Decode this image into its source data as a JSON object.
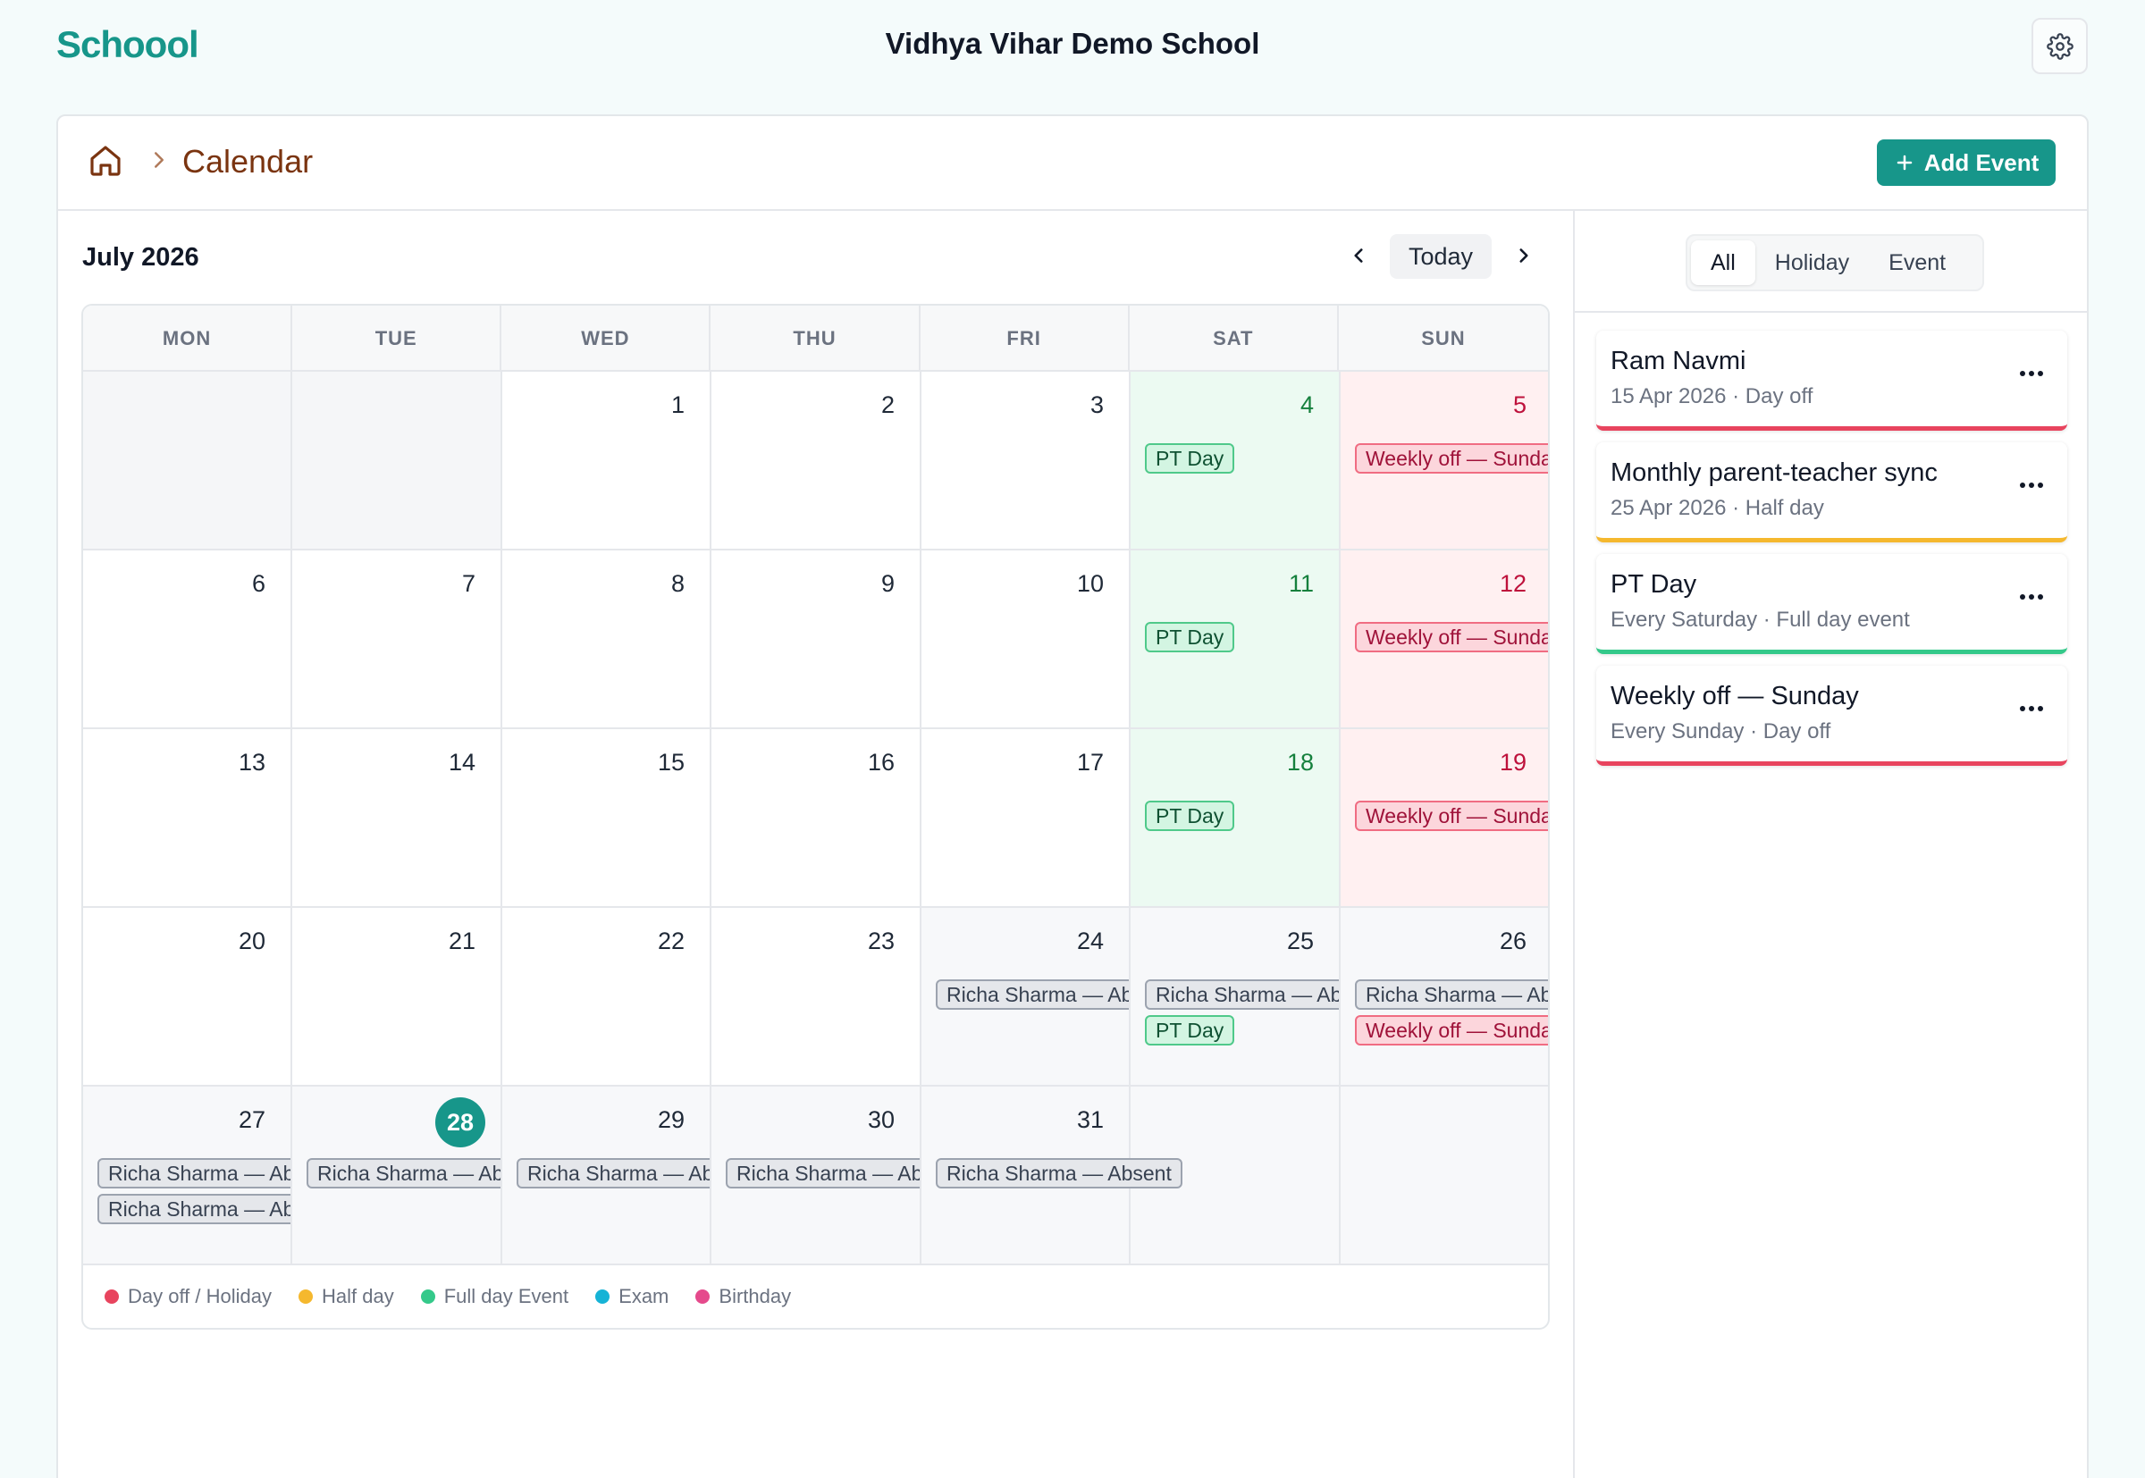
{
  "app": {
    "logo": "Schoool",
    "school_name": "Vidhya Vihar Demo School"
  },
  "breadcrumb": {
    "page_title": "Calendar"
  },
  "toolbar": {
    "add_event_label": "Add Event"
  },
  "calendar": {
    "month_label": "July 2026",
    "today_label": "Today",
    "weekdays": [
      "MON",
      "TUE",
      "WED",
      "THU",
      "FRI",
      "SAT",
      "SUN"
    ],
    "days": {
      "d1": "1",
      "d2": "2",
      "d3": "3",
      "d4": "4",
      "d5": "5",
      "d6": "6",
      "d7": "7",
      "d8": "8",
      "d9": "9",
      "d10": "10",
      "d11": "11",
      "d12": "12",
      "d13": "13",
      "d14": "14",
      "d15": "15",
      "d16": "16",
      "d17": "17",
      "d18": "18",
      "d19": "19",
      "d20": "20",
      "d21": "21",
      "d22": "22",
      "d23": "23",
      "d24": "24",
      "d25": "25",
      "d26": "26",
      "d27": "27",
      "d28": "28",
      "d29": "29",
      "d30": "30",
      "d31": "31"
    },
    "event_labels": {
      "pt_day": "PT Day",
      "weekly_off": "Weekly off — Sunda",
      "absent_short": "Richa Sharma — Ab",
      "absent_full": "Richa Sharma — Absent"
    },
    "legend": [
      {
        "label": "Day off / Holiday",
        "color": "#e8445e"
      },
      {
        "label": "Half day",
        "color": "#f5b82e"
      },
      {
        "label": "Full day Event",
        "color": "#34c98a"
      },
      {
        "label": "Exam",
        "color": "#16b3d6"
      },
      {
        "label": "Birthday",
        "color": "#e54a8c"
      }
    ]
  },
  "sidebar": {
    "filters": [
      "All",
      "Holiday",
      "Event"
    ],
    "active_filter": "All",
    "events": [
      {
        "title": "Ram Navmi",
        "subtitle": "15 Apr 2026 · Day off",
        "color": "#e8445e"
      },
      {
        "title": "Monthly parent-teacher sync",
        "subtitle": "25 Apr 2026 · Half day",
        "color": "#f5b82e"
      },
      {
        "title": "PT Day",
        "subtitle": "Every Saturday · Full day event",
        "color": "#34c98a"
      },
      {
        "title": "Weekly off — Sunday",
        "subtitle": "Every Sunday · Day off",
        "color": "#e8445e"
      }
    ]
  },
  "colors": {
    "brand": "#17968a",
    "title_brown": "#7a3410"
  }
}
